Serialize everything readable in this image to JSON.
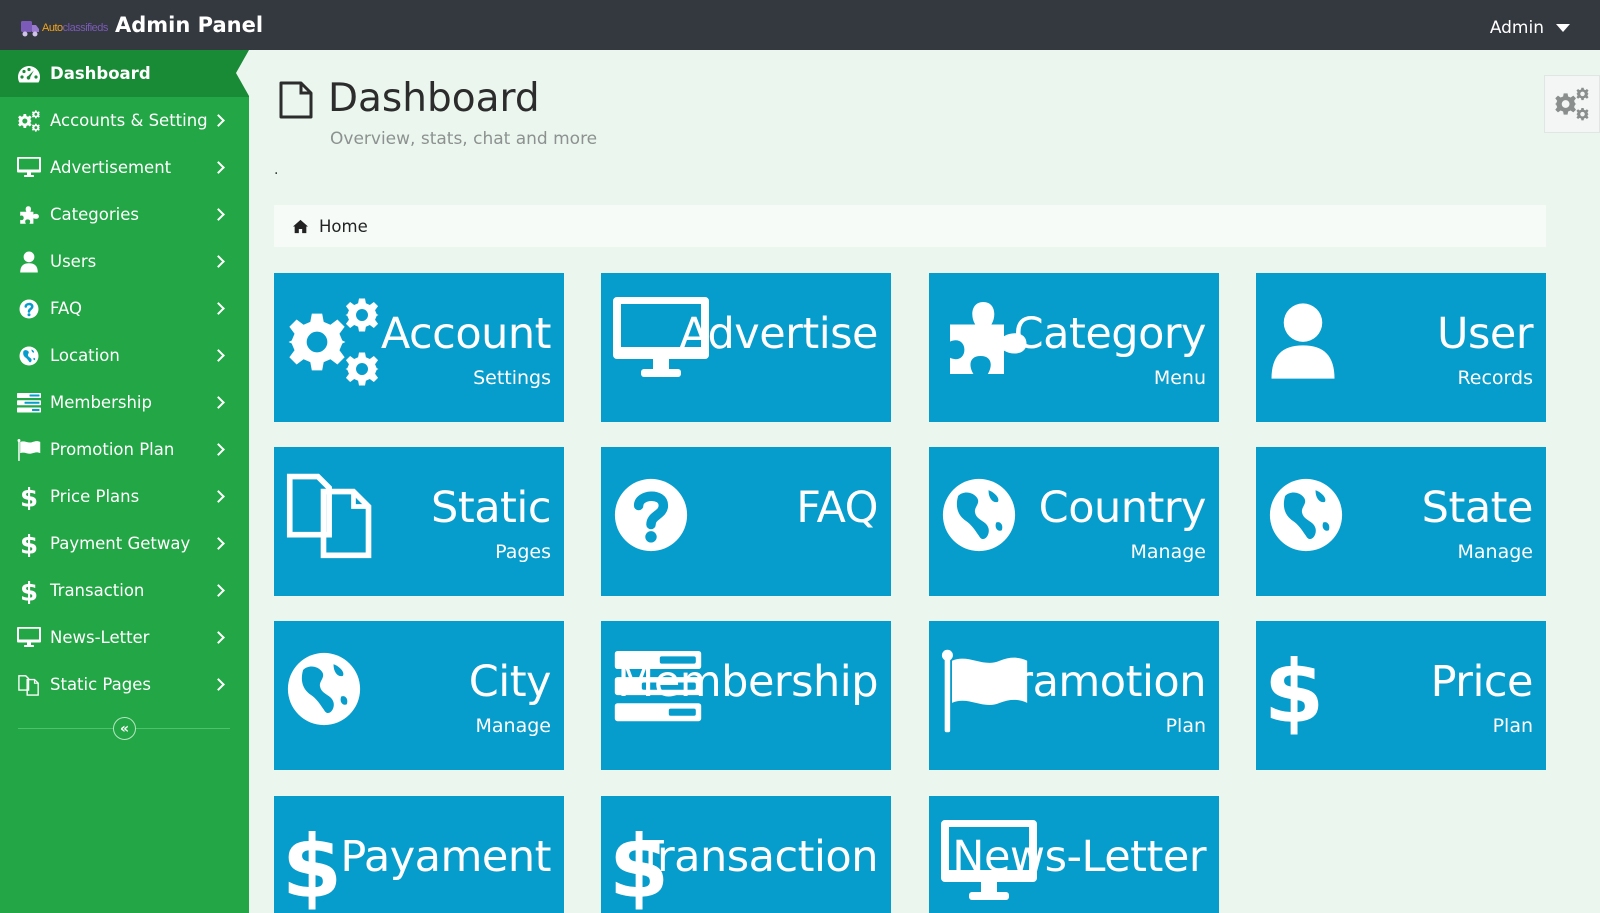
{
  "header": {
    "logo_text_a": "Auto",
    "logo_text_b": "classifieds",
    "title": "Admin Panel",
    "user_menu_label": "Admin"
  },
  "sidebar": {
    "items": [
      {
        "label": "Dashboard",
        "icon": "dashboard-icon",
        "active": true
      },
      {
        "label": "Accounts & Setting",
        "icon": "gears-icon"
      },
      {
        "label": "Advertisement",
        "icon": "desktop-icon"
      },
      {
        "label": "Categories",
        "icon": "puzzle-icon"
      },
      {
        "label": "Users",
        "icon": "user-icon"
      },
      {
        "label": "FAQ",
        "icon": "question-circle-icon"
      },
      {
        "label": "Location",
        "icon": "globe-icon"
      },
      {
        "label": "Membership",
        "icon": "tasks-icon"
      },
      {
        "label": "Promotion Plan",
        "icon": "flag-icon"
      },
      {
        "label": "Price Plans",
        "icon": "dollar-icon"
      },
      {
        "label": "Payment Getway",
        "icon": "dollar-icon"
      },
      {
        "label": "Transaction",
        "icon": "dollar-icon"
      },
      {
        "label": "News-Letter",
        "icon": "desktop-icon"
      },
      {
        "label": "Static Pages",
        "icon": "copy-icon"
      }
    ],
    "collapse_label": "«"
  },
  "page": {
    "title": "Dashboard",
    "subtitle": "Overview, stats, chat and more",
    "dot": ".",
    "breadcrumb": "Home"
  },
  "tiles": [
    {
      "big": "Account",
      "small": "Settings",
      "icon": "gears-icon"
    },
    {
      "big": "Advertise",
      "small": "",
      "icon": "desktop-icon"
    },
    {
      "big": "Category",
      "small": "Menu",
      "icon": "puzzle-icon"
    },
    {
      "big": "User",
      "small": "Records",
      "icon": "user-icon"
    },
    {
      "big": "Static",
      "small": "Pages",
      "icon": "copy-icon"
    },
    {
      "big": "FAQ",
      "small": "",
      "icon": "question-circle-icon"
    },
    {
      "big": "Country",
      "small": "Manage",
      "icon": "globe-icon"
    },
    {
      "big": "State",
      "small": "Manage",
      "icon": "globe-icon"
    },
    {
      "big": "City",
      "small": "Manage",
      "icon": "globe-icon"
    },
    {
      "big": "Membership",
      "small": "",
      "icon": "tasks-icon"
    },
    {
      "big": "Pramotion",
      "small": "Plan",
      "icon": "flag-icon"
    },
    {
      "big": "Price",
      "small": "Plan",
      "icon": "dollar-icon"
    },
    {
      "big": "Payament",
      "small": "",
      "icon": "dollar-icon"
    },
    {
      "big": "Transaction",
      "small": "",
      "icon": "dollar-icon"
    },
    {
      "big": "News-Letter",
      "small": "",
      "icon": "desktop-icon"
    }
  ],
  "colors": {
    "topbar": "#34383f",
    "sidebar": "#23a645",
    "sidebar_active": "#198a36",
    "tile": "#069ccc",
    "background": "#eaf6ee"
  }
}
